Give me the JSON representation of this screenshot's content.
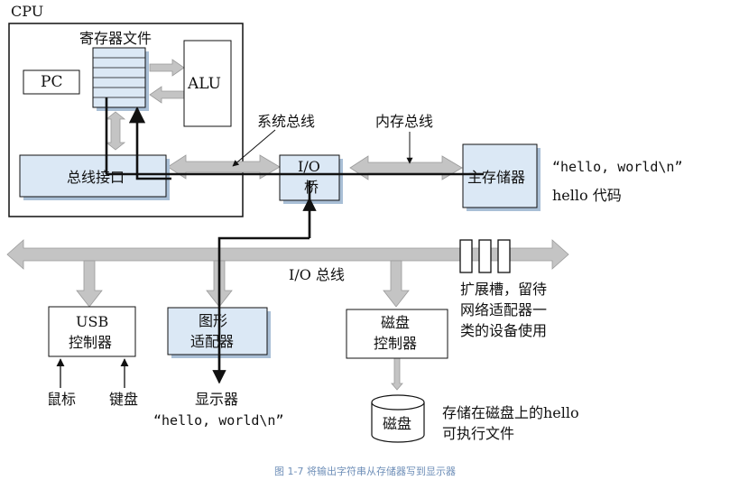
{
  "cpu": {
    "label": "CPU"
  },
  "register_file": {
    "label": "寄存器文件"
  },
  "pc": {
    "label": "PC"
  },
  "alu": {
    "label": "ALU"
  },
  "bus_interface": {
    "label": "总线接口"
  },
  "io_bridge": {
    "line1": "I/O",
    "line2": "桥"
  },
  "main_memory": {
    "label": "主存储器",
    "content": "“hello, world\\n”",
    "code": "hello 代码"
  },
  "buses": {
    "system": "系统总线",
    "memory": "内存总线",
    "io": "I/O 总线"
  },
  "usb": {
    "line1": "USB",
    "line2": "控制器",
    "mouse": "鼠标",
    "keyboard": "键盘"
  },
  "graphics": {
    "line1": "图形",
    "line2": "适配器",
    "display": "显示器",
    "output": "“hello, world\\n”"
  },
  "disk_controller": {
    "line1": "磁盘",
    "line2": "控制器"
  },
  "disk": {
    "label": "磁盘",
    "note_line1": "存储在磁盘上的hello",
    "note_line2": "可执行文件"
  },
  "expansion": {
    "line1": "扩展槽，留待",
    "line2": "网络适配器一",
    "line3": "类的设备使用"
  },
  "caption": "图 1-7 将输出字符串从存储器写到显示器",
  "colors": {
    "box_fill": "#dbe8f5",
    "box_shadow": "#a9bfd6",
    "bus_gray": "#c4c4c4",
    "data_line": "#111111",
    "caption": "#6f8fb8"
  }
}
